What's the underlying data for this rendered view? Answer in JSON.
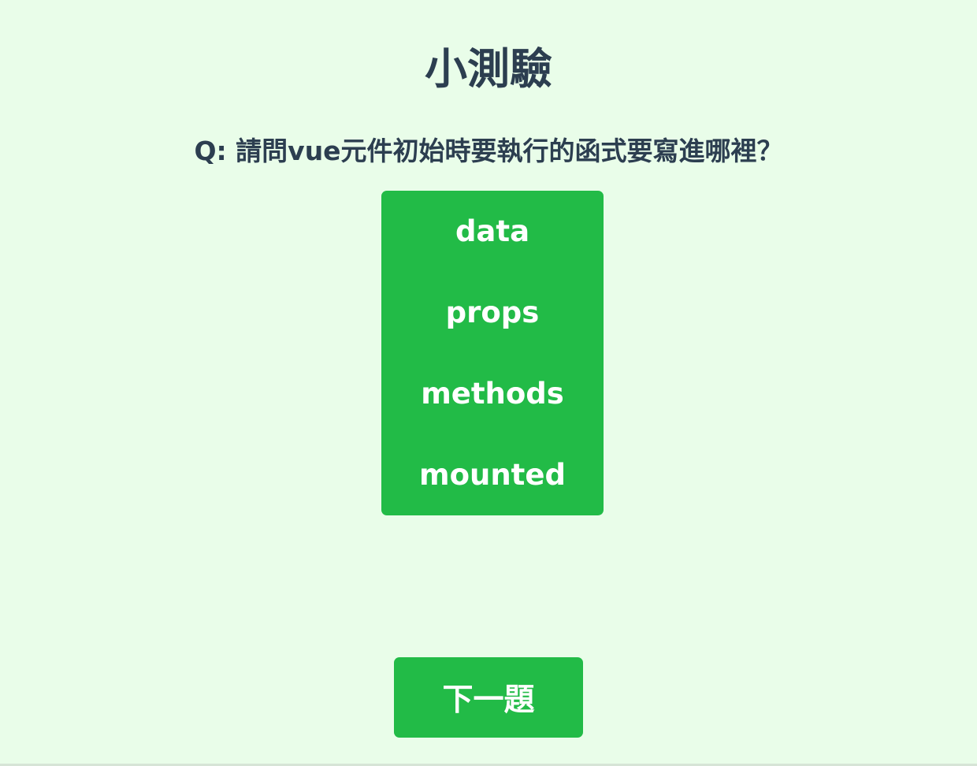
{
  "quiz": {
    "title": "小測驗",
    "question": "Q: 請問vue元件初始時要執行的函式要寫進哪裡？",
    "options": [
      {
        "label": "data"
      },
      {
        "label": "props"
      },
      {
        "label": "methods"
      },
      {
        "label": "mounted"
      }
    ],
    "next_label": "下一題"
  },
  "colors": {
    "background": "#e9fde9",
    "accent": "#22bb47",
    "text": "#2c3e50",
    "button_text": "#ffffff"
  }
}
